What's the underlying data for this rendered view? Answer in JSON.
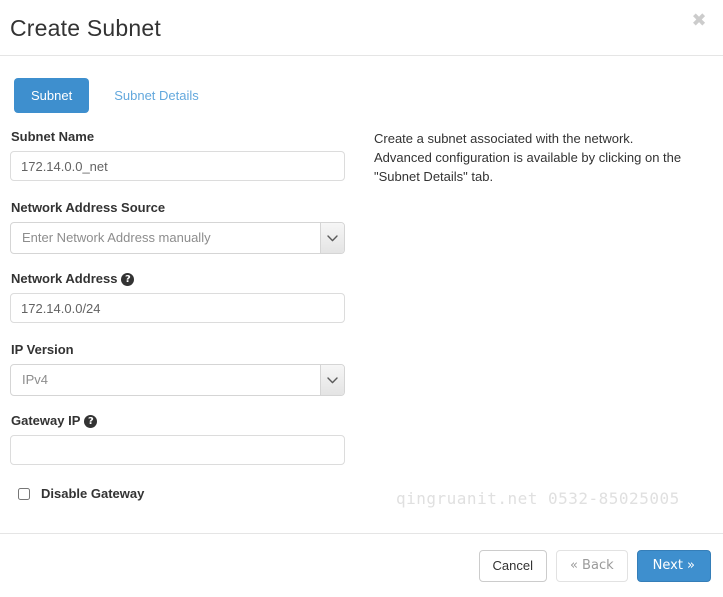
{
  "modal": {
    "title": "Create Subnet",
    "close_icon": "close-icon",
    "close_glyph": "✖"
  },
  "tabs": [
    {
      "label": "Subnet",
      "active": true
    },
    {
      "label": "Subnet Details",
      "active": false
    }
  ],
  "form": {
    "subnet_name": {
      "label": "Subnet Name",
      "value": "172.14.0.0_net",
      "placeholder": ""
    },
    "network_address_source": {
      "label": "Network Address Source",
      "value": "Enter Network Address manually",
      "icon": "chevron-down-icon"
    },
    "network_address": {
      "label": "Network Address",
      "help_glyph": "?",
      "value": "172.14.0.0/24",
      "placeholder": ""
    },
    "ip_version": {
      "label": "IP Version",
      "value": "IPv4",
      "icon": "chevron-down-icon"
    },
    "gateway_ip": {
      "label": "Gateway IP",
      "help_glyph": "?",
      "value": "",
      "placeholder": ""
    },
    "disable_gateway": {
      "label": "Disable Gateway",
      "checked": false
    }
  },
  "help": {
    "text": "Create a subnet associated with the network. Advanced configuration is available by clicking on the \"Subnet Details\" tab."
  },
  "watermark": {
    "text": "qingruanit.net 0532-85025005"
  },
  "footer": {
    "cancel": "Cancel",
    "back": "«  Back",
    "next": "Next  »"
  },
  "colors": {
    "primary_blue": "#3e8fce",
    "link_blue": "#63a8dd",
    "border_gray": "#e5e5e5",
    "text": "#333333",
    "muted": "#8d8d8d",
    "watermark": "#e0e0e0"
  }
}
